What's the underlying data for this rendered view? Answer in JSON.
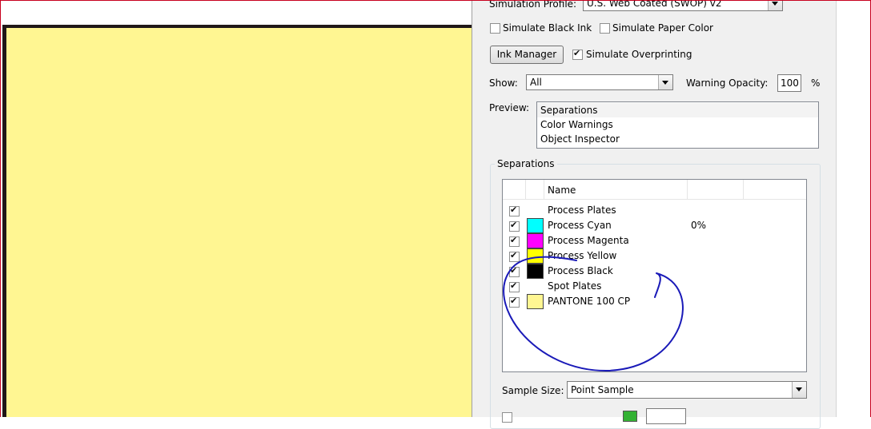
{
  "panel": {
    "simulation_profile_label": "Simulation Profile:",
    "simulation_profile_value": "U.S. Web Coated (SWOP) v2",
    "simulate_black_ink_label": "Simulate Black Ink",
    "simulate_black_ink_checked": false,
    "simulate_paper_color_label": "Simulate Paper Color",
    "simulate_paper_color_checked": false,
    "ink_manager_label": "Ink Manager",
    "simulate_overprinting_label": "Simulate Overprinting",
    "simulate_overprinting_checked": true,
    "show_label": "Show:",
    "show_value": "All",
    "warning_opacity_label": "Warning Opacity:",
    "warning_opacity_value": "100",
    "warning_opacity_unit": "%",
    "preview_label": "Preview:",
    "preview_items": [
      "Separations",
      "Color Warnings",
      "Object Inspector"
    ],
    "preview_selected": "Separations",
    "separations_title": "Separations",
    "table_header_name": "Name",
    "sample_size_label": "Sample Size:",
    "sample_size_value": "Point Sample"
  },
  "separations": [
    {
      "name": "Process Plates",
      "checked": true,
      "swatch": null,
      "value": ""
    },
    {
      "name": "Process Cyan",
      "checked": true,
      "swatch": "#00ffff",
      "value": "0%"
    },
    {
      "name": "Process Magenta",
      "checked": true,
      "swatch": "#ff00ff",
      "value": ""
    },
    {
      "name": "Process Yellow",
      "checked": true,
      "swatch": "#ffff00",
      "value": ""
    },
    {
      "name": "Process Black",
      "checked": true,
      "swatch": "#000000",
      "value": ""
    },
    {
      "name": "Spot Plates",
      "checked": true,
      "swatch": null,
      "value": ""
    },
    {
      "name": "PANTONE 100 CP",
      "checked": true,
      "swatch": "#fff692",
      "value": ""
    }
  ],
  "colors": {
    "canvas_fill": "#fff692",
    "annotation_stroke": "#1a1ab8",
    "frame_red": "#c8001e"
  }
}
